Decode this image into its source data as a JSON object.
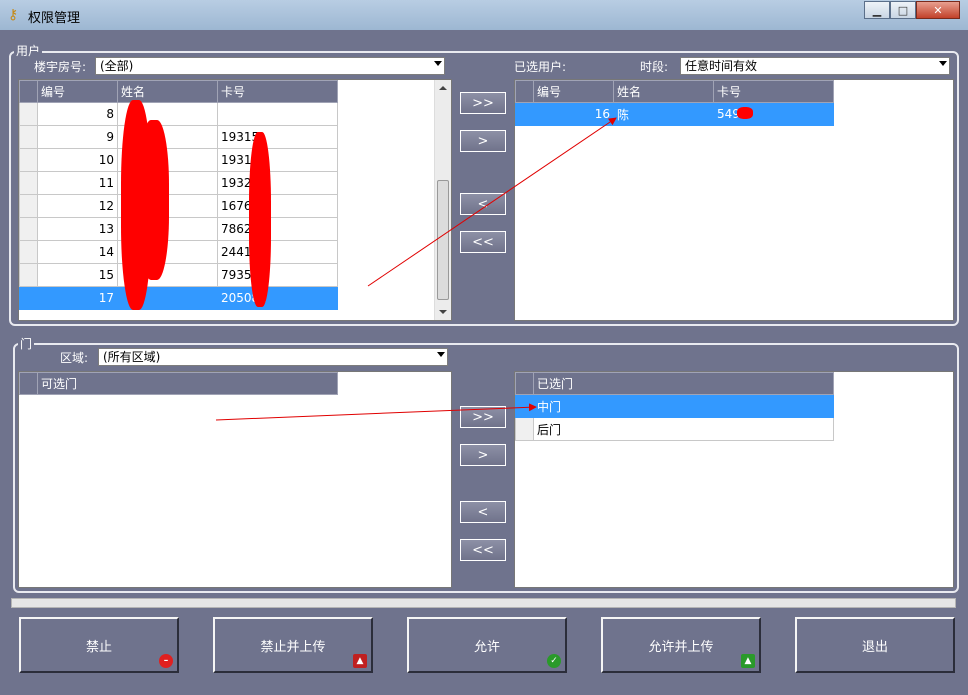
{
  "window": {
    "title": "权限管理"
  },
  "users_group": {
    "label": "用户",
    "building_label": "楼宇房号:",
    "building_value": "(全部)",
    "selected_label": "已选用户:",
    "period_label": "时段:",
    "period_value": "任意时间有效",
    "columns": [
      "编号",
      "姓名",
      "卡号"
    ],
    "available_rows": [
      {
        "id": "8",
        "name": "",
        "card": ""
      },
      {
        "id": "9",
        "name": "",
        "card": "19315"
      },
      {
        "id": "10",
        "name": "",
        "card": "19315"
      },
      {
        "id": "11",
        "name": "",
        "card": "19323"
      },
      {
        "id": "12",
        "name": "",
        "card": "16761"
      },
      {
        "id": "13",
        "name": "",
        "card": "78628"
      },
      {
        "id": "14",
        "name": "",
        "card": "24410"
      },
      {
        "id": "15",
        "name": "",
        "card": "79352"
      },
      {
        "id": "17",
        "name": "",
        "card": "205082"
      }
    ],
    "selected_rows": [
      {
        "id": "16",
        "name": "陈",
        "card": "5495"
      }
    ]
  },
  "doors_group": {
    "label": "门",
    "area_label": "区域:",
    "area_value": "(所有区域)",
    "available_header": "可选门",
    "selected_header": "已选门",
    "selected_rows": [
      "中门",
      "后门"
    ]
  },
  "move_buttons": {
    "add_all": ">>",
    "add": ">",
    "remove": "<",
    "remove_all": "<<"
  },
  "actions": {
    "deny": "禁止",
    "deny_upload": "禁止并上传",
    "allow": "允许",
    "allow_upload": "允许并上传",
    "exit": "退出"
  }
}
